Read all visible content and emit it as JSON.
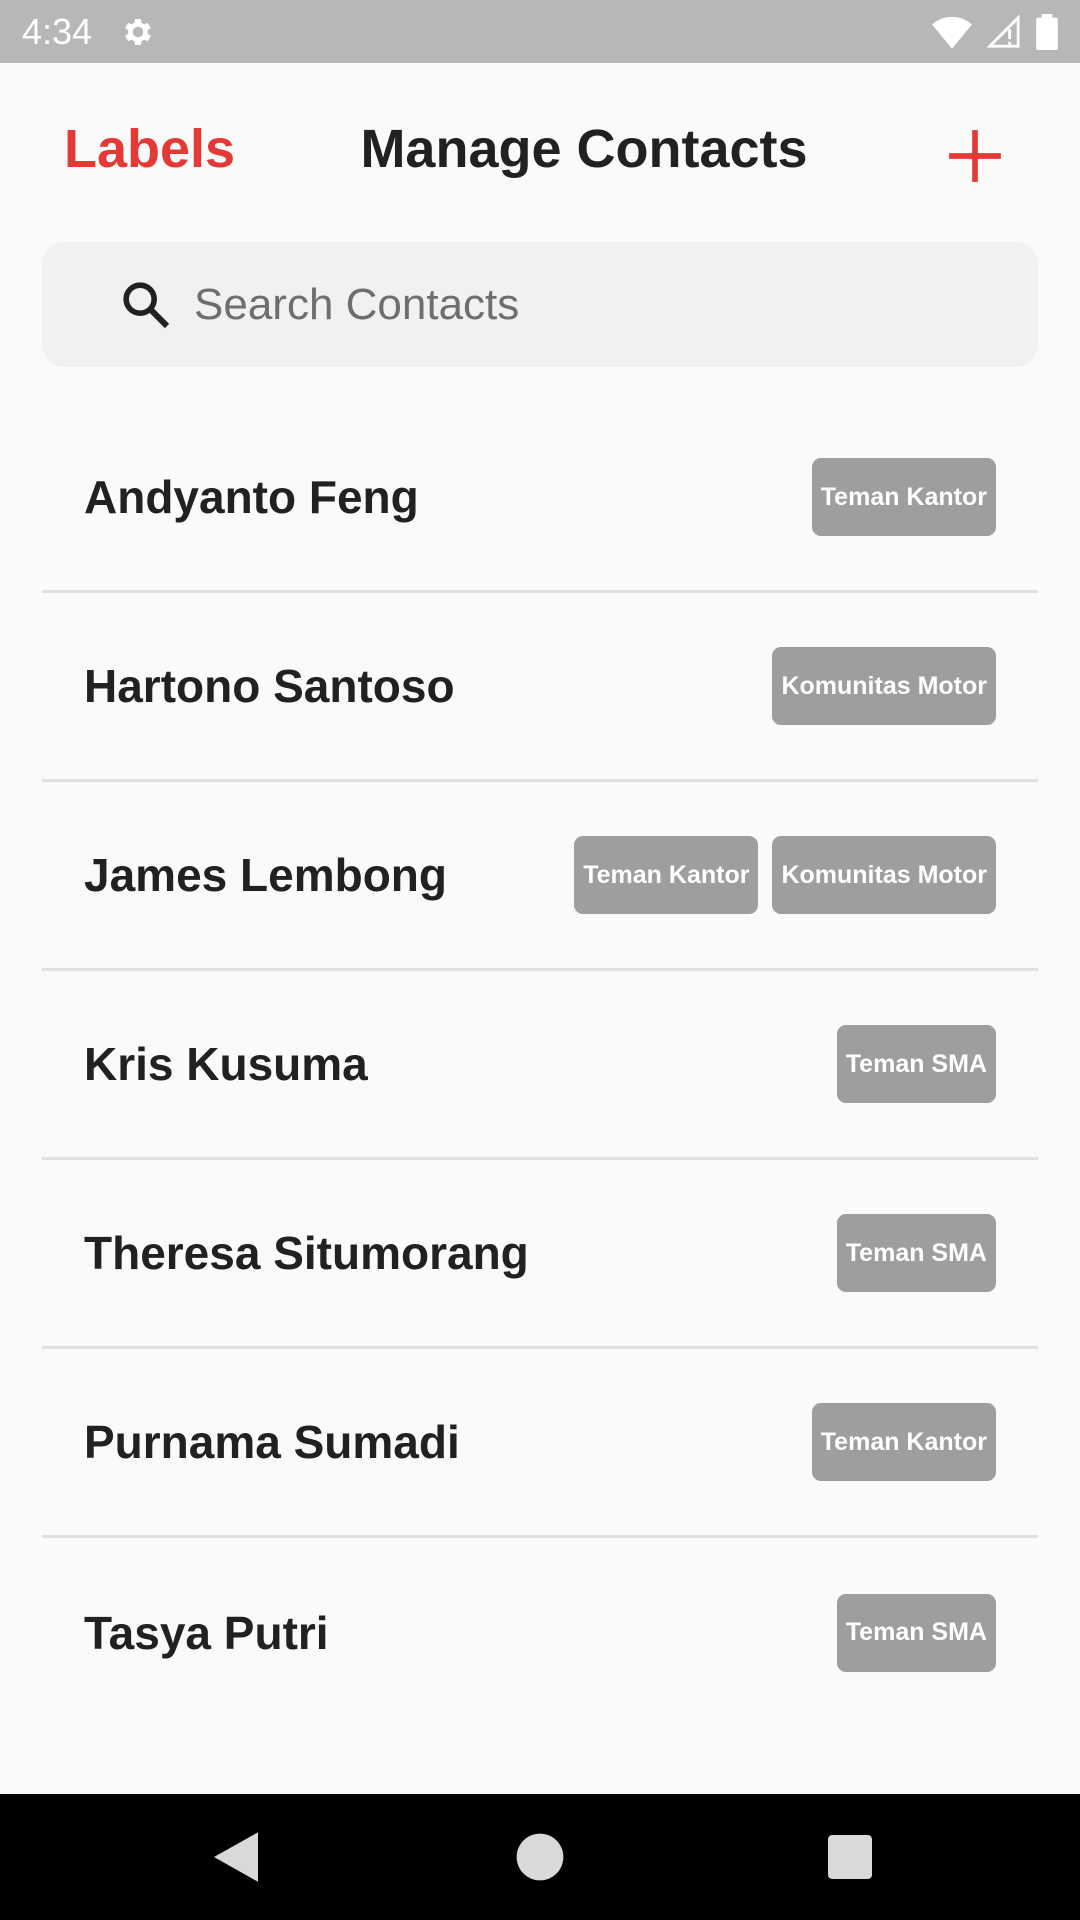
{
  "status_bar": {
    "time": "4:34",
    "icons": [
      "gear-icon",
      "wifi-icon",
      "signal-icon",
      "battery-icon"
    ]
  },
  "header": {
    "labels_link": "Labels",
    "title": "Manage Contacts",
    "add_icon": "plus-icon"
  },
  "search": {
    "placeholder": "Search Contacts",
    "value": "",
    "icon": "search-icon"
  },
  "contacts": [
    {
      "name": "Andyanto Feng",
      "tags": [
        "Teman Kantor"
      ]
    },
    {
      "name": "Hartono Santoso",
      "tags": [
        "Komunitas Motor"
      ]
    },
    {
      "name": "James Lembong",
      "tags": [
        "Teman Kantor",
        "Komunitas Motor"
      ]
    },
    {
      "name": "Kris Kusuma",
      "tags": [
        "Teman SMA"
      ]
    },
    {
      "name": "Theresa Situmorang",
      "tags": [
        "Teman SMA"
      ]
    },
    {
      "name": "Purnama Sumadi",
      "tags": [
        "Teman Kantor"
      ]
    },
    {
      "name": "Tasya Putri",
      "tags": [
        "Teman SMA"
      ]
    }
  ],
  "nav_bar": {
    "buttons": [
      "back-icon",
      "home-icon",
      "recents-icon"
    ]
  },
  "colors": {
    "accent": "#e53935",
    "tag_background": "#9e9e9e",
    "status_bar": "#b7b7b7",
    "nav_bar": "#000000"
  }
}
